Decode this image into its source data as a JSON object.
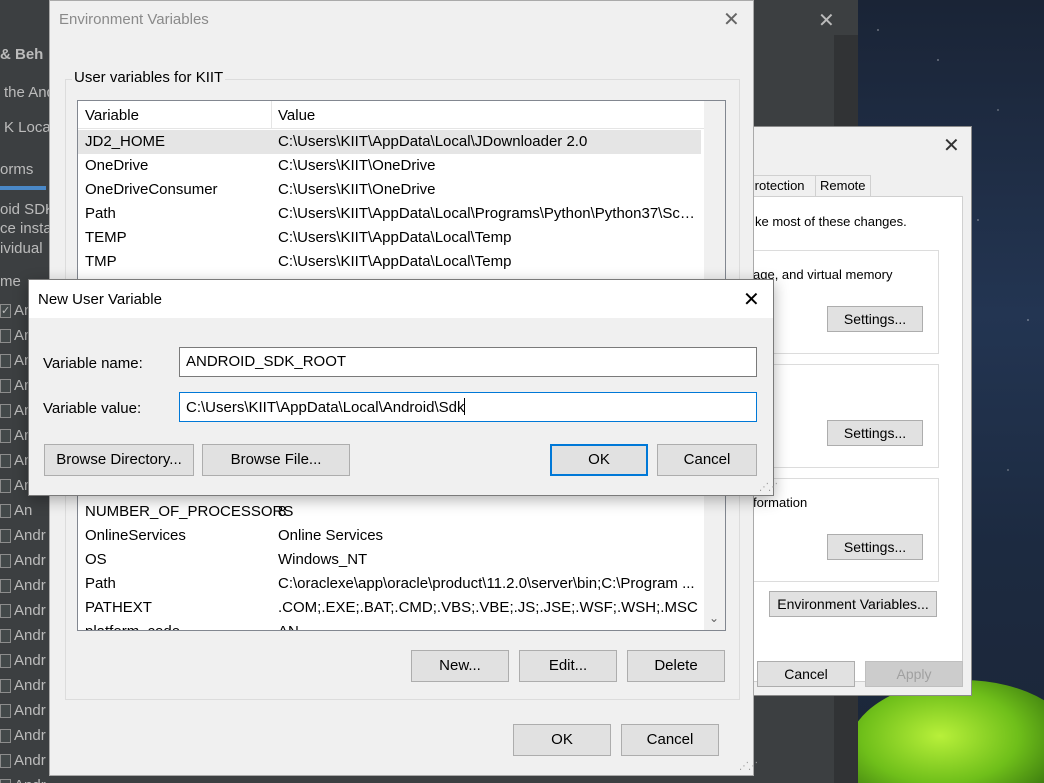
{
  "ide": {
    "lines": [
      "& Beh",
      "the And",
      "K Locati",
      "orms",
      "oid SDK",
      "ce insta",
      "ividual",
      "me"
    ],
    "checkbox_labels": [
      "An",
      "An",
      "An",
      "An",
      "An",
      "An",
      "An",
      "An",
      "An",
      "Andr",
      "Andr",
      "Andr",
      "Andr",
      "Andr",
      "Andr",
      "Andr",
      "Andr",
      "Andr",
      "Andr",
      "Andr",
      "Andr"
    ]
  },
  "system_properties": {
    "tabs": [
      "Protection",
      "Remote"
    ],
    "admin_note": "ke most of these changes.",
    "performance_text": "age, and virtual memory",
    "startup_text": "formation",
    "settings_label": "Settings...",
    "env_vars_button": "Environment Variables...",
    "cancel_label": "Cancel",
    "apply_label": "Apply"
  },
  "env_vars": {
    "title": "Environment Variables",
    "user_group_label": "User variables for KIIT",
    "columns": {
      "variable": "Variable",
      "value": "Value"
    },
    "user_vars": [
      {
        "name": "JD2_HOME",
        "value": "C:\\Users\\KIIT\\AppData\\Local\\JDownloader 2.0"
      },
      {
        "name": "OneDrive",
        "value": "C:\\Users\\KIIT\\OneDrive"
      },
      {
        "name": "OneDriveConsumer",
        "value": "C:\\Users\\KIIT\\OneDrive"
      },
      {
        "name": "Path",
        "value": "C:\\Users\\KIIT\\AppData\\Local\\Programs\\Python\\Python37\\Scri..."
      },
      {
        "name": "TEMP",
        "value": "C:\\Users\\KIIT\\AppData\\Local\\Temp"
      },
      {
        "name": "TMP",
        "value": "C:\\Users\\KIIT\\AppData\\Local\\Temp"
      }
    ],
    "system_vars": [
      {
        "name": "NUMBER_OF_PROCESSORS",
        "value": "8"
      },
      {
        "name": "OnlineServices",
        "value": "Online Services"
      },
      {
        "name": "OS",
        "value": "Windows_NT"
      },
      {
        "name": "Path",
        "value": "C:\\oraclexe\\app\\oracle\\product\\11.2.0\\server\\bin;C:\\Program ..."
      },
      {
        "name": "PATHEXT",
        "value": ".COM;.EXE;.BAT;.CMD;.VBS;.VBE;.JS;.JSE;.WSF;.WSH;.MSC"
      },
      {
        "name": "platform_code",
        "value": "AN"
      }
    ],
    "buttons": {
      "new": "New...",
      "edit": "Edit...",
      "delete": "Delete",
      "ok": "OK",
      "cancel": "Cancel"
    }
  },
  "new_user_variable": {
    "title": "New User Variable",
    "name_label": "Variable name:",
    "name_value": "ANDROID_SDK_ROOT",
    "value_label": "Variable value:",
    "value_value": "C:\\Users\\KIIT\\AppData\\Local\\Android\\Sdk",
    "browse_directory": "Browse Directory...",
    "browse_file": "Browse File...",
    "ok": "OK",
    "cancel": "Cancel"
  }
}
